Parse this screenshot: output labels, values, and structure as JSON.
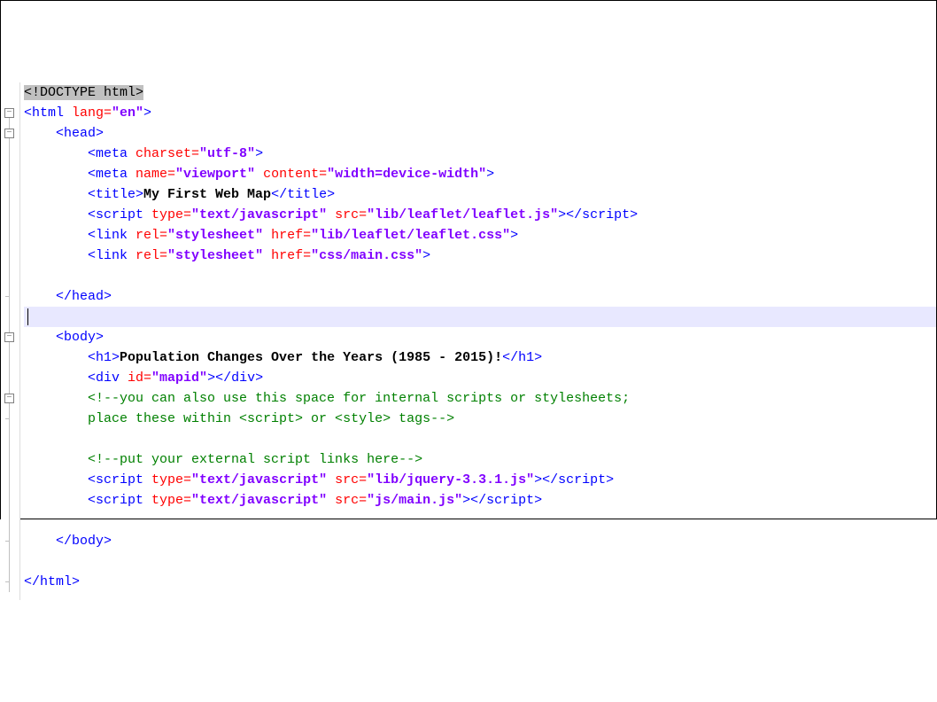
{
  "fold_symbol": "−",
  "lines": [
    {
      "fold": null,
      "segments": [
        {
          "cls": "hl-sel",
          "t": "<!DOCTYPE html>"
        }
      ]
    },
    {
      "fold": "box",
      "segments": [
        {
          "cls": "tag",
          "t": "<html "
        },
        {
          "cls": "attr",
          "t": "lang="
        },
        {
          "cls": "str",
          "t": "\"en\""
        },
        {
          "cls": "tag",
          "t": ">"
        }
      ]
    },
    {
      "fold": "box",
      "indent": 1,
      "segments": [
        {
          "cls": "tag",
          "t": "<head>"
        }
      ]
    },
    {
      "fold": null,
      "indent": 2,
      "segments": [
        {
          "cls": "tag",
          "t": "<meta "
        },
        {
          "cls": "attr",
          "t": "charset="
        },
        {
          "cls": "str",
          "t": "\"utf-8\""
        },
        {
          "cls": "tag",
          "t": ">"
        }
      ]
    },
    {
      "fold": null,
      "indent": 2,
      "segments": [
        {
          "cls": "tag",
          "t": "<meta "
        },
        {
          "cls": "attr",
          "t": "name="
        },
        {
          "cls": "str",
          "t": "\"viewport\""
        },
        {
          "cls": "tag",
          "t": " "
        },
        {
          "cls": "attr",
          "t": "content="
        },
        {
          "cls": "str",
          "t": "\"width=device-width\""
        },
        {
          "cls": "tag",
          "t": ">"
        }
      ]
    },
    {
      "fold": null,
      "indent": 2,
      "segments": [
        {
          "cls": "tag",
          "t": "<title>"
        },
        {
          "cls": "txt",
          "t": "My First Web Map"
        },
        {
          "cls": "tag",
          "t": "</title>"
        }
      ]
    },
    {
      "fold": null,
      "indent": 2,
      "segments": [
        {
          "cls": "tag",
          "t": "<script "
        },
        {
          "cls": "attr",
          "t": "type="
        },
        {
          "cls": "str",
          "t": "\"text/javascript\""
        },
        {
          "cls": "tag",
          "t": " "
        },
        {
          "cls": "attr",
          "t": "src="
        },
        {
          "cls": "str",
          "t": "\"lib/leaflet/leaflet.js\""
        },
        {
          "cls": "tag",
          "t": "></script>"
        }
      ]
    },
    {
      "fold": null,
      "indent": 2,
      "segments": [
        {
          "cls": "tag",
          "t": "<link "
        },
        {
          "cls": "attr",
          "t": "rel="
        },
        {
          "cls": "str",
          "t": "\"stylesheet\""
        },
        {
          "cls": "tag",
          "t": " "
        },
        {
          "cls": "attr",
          "t": "href="
        },
        {
          "cls": "str",
          "t": "\"lib/leaflet/leaflet.css\""
        },
        {
          "cls": "tag",
          "t": ">"
        }
      ]
    },
    {
      "fold": null,
      "indent": 2,
      "segments": [
        {
          "cls": "tag",
          "t": "<link "
        },
        {
          "cls": "attr",
          "t": "rel="
        },
        {
          "cls": "str",
          "t": "\"stylesheet\""
        },
        {
          "cls": "tag",
          "t": " "
        },
        {
          "cls": "attr",
          "t": "href="
        },
        {
          "cls": "str",
          "t": "\"css/main.css\""
        },
        {
          "cls": "tag",
          "t": ">"
        }
      ]
    },
    {
      "fold": null,
      "segments": []
    },
    {
      "fold": "tick",
      "indent": 1,
      "segments": [
        {
          "cls": "tag",
          "t": "</head>"
        }
      ]
    },
    {
      "fold": null,
      "highlight": true,
      "caret": true,
      "segments": []
    },
    {
      "fold": "box",
      "indent": 1,
      "segments": [
        {
          "cls": "tag",
          "t": "<body>"
        }
      ]
    },
    {
      "fold": null,
      "indent": 2,
      "segments": [
        {
          "cls": "tag",
          "t": "<h1>"
        },
        {
          "cls": "txt",
          "t": "Population Changes Over the Years (1985 - 2015)!"
        },
        {
          "cls": "tag",
          "t": "</h1>"
        }
      ]
    },
    {
      "fold": null,
      "indent": 2,
      "segments": [
        {
          "cls": "tag",
          "t": "<div "
        },
        {
          "cls": "attr",
          "t": "id="
        },
        {
          "cls": "str",
          "t": "\"mapid\""
        },
        {
          "cls": "tag",
          "t": "></div>"
        }
      ]
    },
    {
      "fold": "box",
      "indent": 2,
      "segments": [
        {
          "cls": "cmt",
          "t": "<!--you can also use this space for internal scripts or stylesheets;"
        }
      ]
    },
    {
      "fold": "tick",
      "indent": 2,
      "segments": [
        {
          "cls": "cmt",
          "t": "place these within <script> or <style> tags-->"
        }
      ]
    },
    {
      "fold": null,
      "segments": []
    },
    {
      "fold": null,
      "indent": 2,
      "segments": [
        {
          "cls": "cmt",
          "t": "<!--put your external script links here-->"
        }
      ]
    },
    {
      "fold": null,
      "indent": 2,
      "segments": [
        {
          "cls": "tag",
          "t": "<script "
        },
        {
          "cls": "attr",
          "t": "type="
        },
        {
          "cls": "str",
          "t": "\"text/javascript\""
        },
        {
          "cls": "tag",
          "t": " "
        },
        {
          "cls": "attr",
          "t": "src="
        },
        {
          "cls": "str",
          "t": "\"lib/jquery-3.3.1.js\""
        },
        {
          "cls": "tag",
          "t": "></script>"
        }
      ]
    },
    {
      "fold": null,
      "indent": 2,
      "segments": [
        {
          "cls": "tag",
          "t": "<script "
        },
        {
          "cls": "attr",
          "t": "type="
        },
        {
          "cls": "str",
          "t": "\"text/javascript\""
        },
        {
          "cls": "tag",
          "t": " "
        },
        {
          "cls": "attr",
          "t": "src="
        },
        {
          "cls": "str",
          "t": "\"js/main.js\""
        },
        {
          "cls": "tag",
          "t": "></script>"
        }
      ]
    },
    {
      "fold": null,
      "segments": []
    },
    {
      "fold": "tick",
      "indent": 1,
      "segments": [
        {
          "cls": "tag",
          "t": "</body>"
        }
      ]
    },
    {
      "fold": null,
      "segments": []
    },
    {
      "fold": "tick",
      "segments": [
        {
          "cls": "tag",
          "t": "</html>"
        }
      ]
    }
  ]
}
